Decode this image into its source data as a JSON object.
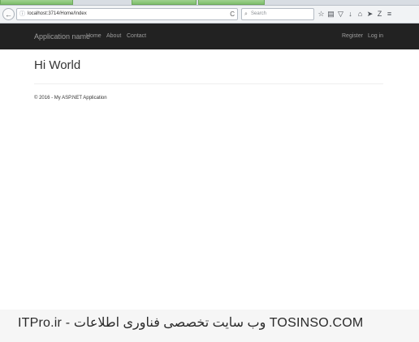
{
  "browser": {
    "address": "localhost:3714/Home/Index",
    "search_placeholder": "Search",
    "reload_glyph": "C",
    "back_glyph": "←",
    "info_glyph": "ⓘ",
    "search_glyph": "⌕",
    "toolbar_icons": [
      {
        "name": "star-icon",
        "glyph": "☆"
      },
      {
        "name": "reading-list-icon",
        "glyph": "▤"
      },
      {
        "name": "pocket-icon",
        "glyph": "▽"
      },
      {
        "name": "download-icon",
        "glyph": "↓"
      },
      {
        "name": "home-icon",
        "glyph": "⌂"
      },
      {
        "name": "send-icon",
        "glyph": "➤"
      },
      {
        "name": "zotero-icon",
        "glyph": "Z"
      },
      {
        "name": "menu-icon",
        "glyph": "≡"
      }
    ]
  },
  "navbar": {
    "brand": "Application name",
    "links": [
      "Home",
      "About",
      "Contact"
    ],
    "right_links": [
      "Register",
      "Log in"
    ]
  },
  "page": {
    "title": "Hi World",
    "footer": "© 2016 - My ASP.NET Application"
  },
  "watermark": {
    "text": "ITPro.ir - وب سایت تخصصی فناوری اطلاعات TOSINSO.COM"
  }
}
